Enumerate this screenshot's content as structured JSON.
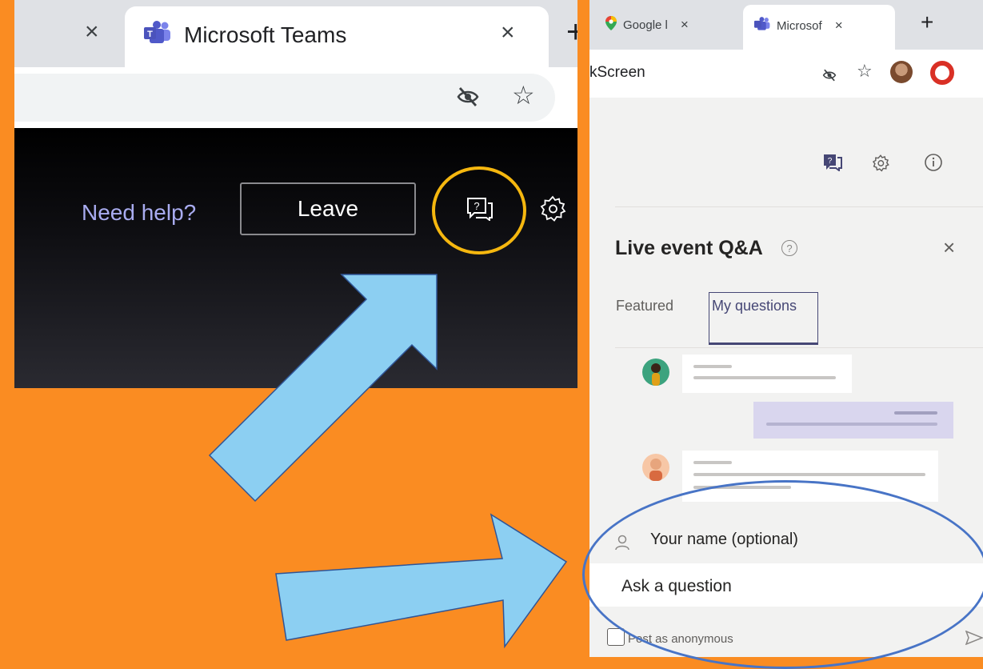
{
  "colors": {
    "background": "#fa8c22",
    "arrow_fill": "#8ccff2",
    "arrow_stroke": "#2f5597",
    "highlight_ring_yellow": "#f5b70f",
    "highlight_ring_blue": "#4874c6",
    "teams_accent": "#464775",
    "need_help_link": "#a9acf0"
  },
  "left_screenshot": {
    "tab": {
      "title": "Microsoft Teams",
      "close": "×",
      "prev_close": "×",
      "new_tab": "+"
    },
    "toolbar": {
      "eye_icon": "eye-off-icon",
      "star_icon": "☆"
    },
    "header": {
      "need_help": "Need help?",
      "leave_label": "Leave",
      "qa_icon": "qa-chat-icon",
      "settings_icon": "gear-icon"
    }
  },
  "right_screenshot": {
    "tabs": [
      {
        "title": "Google l",
        "close": "×",
        "icon": "maps-pin-icon"
      },
      {
        "title": "Microsof",
        "close": "×",
        "icon": "teams-icon"
      }
    ],
    "new_tab": "+",
    "url_fragment": "kScreen",
    "toolbar": {
      "star_icon": "☆"
    },
    "qa_panel": {
      "title": "Live event Q&A",
      "help_icon": "?",
      "close": "×",
      "tabs": [
        "Featured",
        "My questions"
      ],
      "active_tab": "My questions",
      "name_placeholder": "Your name (optional)",
      "ask_placeholder": "Ask a question",
      "anonymous_label": "Post as anonymous"
    }
  }
}
